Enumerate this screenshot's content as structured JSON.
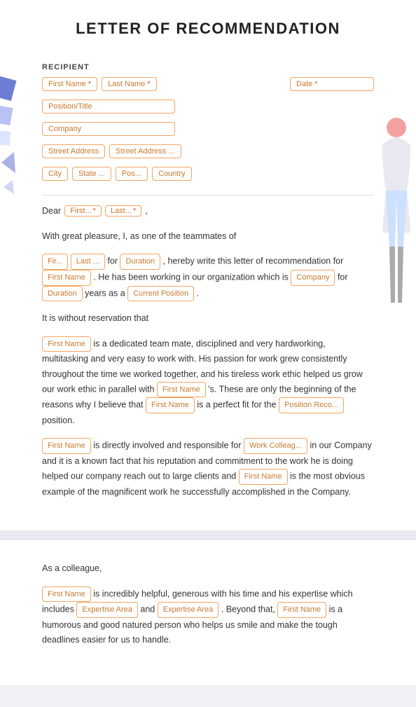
{
  "header": {
    "title": "LETTER OF RECOMMENDATION"
  },
  "recipient": {
    "label": "RECIPIENT",
    "fields": {
      "first_name": "First Name",
      "last_name": "Last Name",
      "position_title": "Position/Title",
      "company": "Company",
      "street_address1": "Street Address",
      "street_address2": "Street Address ...",
      "city": "City",
      "state": "State ...",
      "postal": "Pos...",
      "country": "Country",
      "date": "Date"
    }
  },
  "dear_line": {
    "dear": "Dear",
    "first": "First...",
    "last": "Last...",
    "comma": ","
  },
  "paragraph1": {
    "intro": "With great pleasure, I, as one of the teammates of",
    "fir": "Fir...",
    "last": "Last ...",
    "for1": "for",
    "duration1": "Duration",
    "hereby": ", hereby write this letter of recommendation for",
    "first_name1": "First Name",
    "he_worked": ". He has been working in our organization which is",
    "company": "Company",
    "for2": "for",
    "duration2": "Duration",
    "years": "years as a",
    "current_position": "Current Position"
  },
  "paragraph2": {
    "intro": "It is without reservation that",
    "first_name": "First Name",
    "dedicated": "is a dedicated team mate, disciplined and very hardworking, multitasking and very easy to work with. His passion for work grew consistently throughout the time we worked together, and his tireless work ethic helped us grow our work ethic in parallel with",
    "first_name2": "First Name",
    "s_these": "'s. These are only the beginning of the reasons why I believe that",
    "first_name3": "First Name",
    "perfect_fit": "is a perfect fit for the",
    "position_reco": "Position Reco...",
    "position_end": "position."
  },
  "paragraph3": {
    "first_name1": "First Name",
    "directly": "is directly involved and responsible for",
    "work_colleague": "Work Colleag...",
    "known_fact": "in our Company and it is a known fact that his reputation and commitment to the work he is doing helped our company reach out to large clients and",
    "first_name2": "First Name",
    "most_obvious": "is the most obvious example of the magnificent work he successfully accomplished in the Company."
  },
  "paragraph4": {
    "colleague": "As a colleague,",
    "first_name": "First Name",
    "incredibly": "is incredibly helpful, generous with his time and his expertise which includes",
    "expertise1": "Expertise Area",
    "and": "and",
    "expertise2": "Expertise Area",
    "beyond": ". Beyond that,",
    "first_name2": "First Name",
    "humorous": "is a humorous and good natured person who helps us smile and make the tough deadlines easier for us to handle."
  }
}
